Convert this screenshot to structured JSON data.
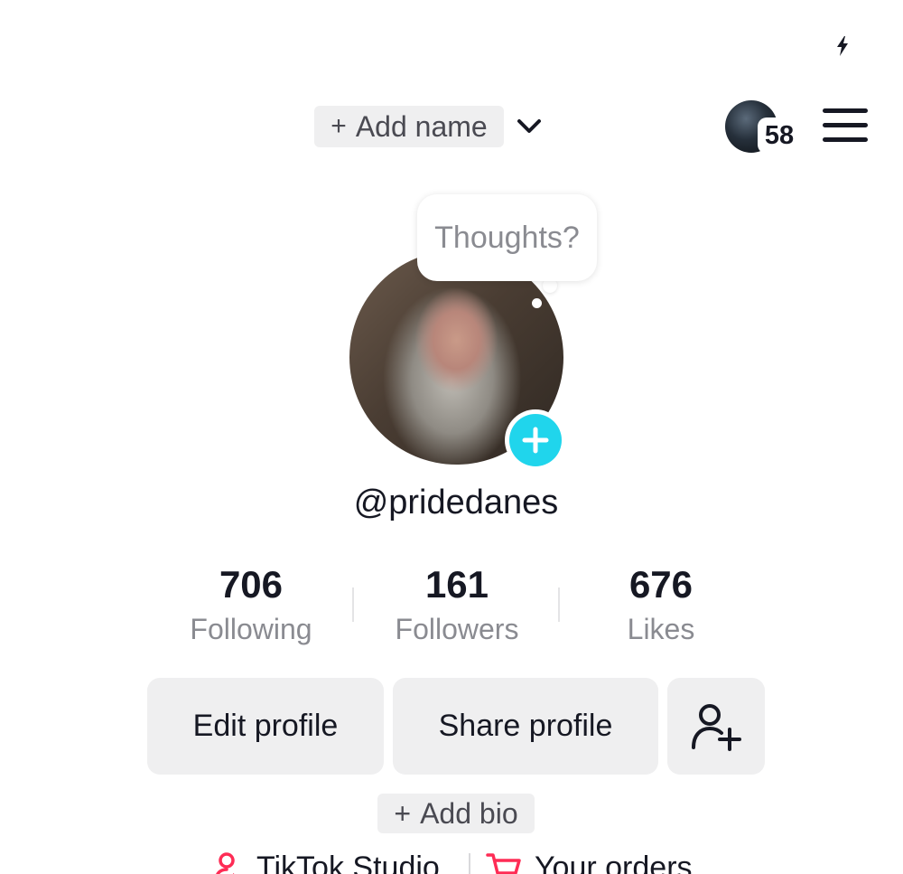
{
  "status": {
    "icon": "flash-icon"
  },
  "header": {
    "add_name_plus": "+",
    "add_name_label": "Add name",
    "dropdown_icon": "chevron-down-icon",
    "story_count": "58",
    "menu_icon": "hamburger-menu-icon"
  },
  "profile": {
    "thought_prompt": "Thoughts?",
    "username": "@pridedanes",
    "avatar_add_icon": "plus-icon"
  },
  "stats": [
    {
      "value": "706",
      "label": "Following"
    },
    {
      "value": "161",
      "label": "Followers"
    },
    {
      "value": "676",
      "label": "Likes"
    }
  ],
  "actions": {
    "edit_profile": "Edit profile",
    "share_profile": "Share profile",
    "add_friend_icon": "add-user-icon"
  },
  "bio": {
    "plus": "+",
    "label": "Add bio"
  },
  "links": [
    {
      "label": "TikTok Studio",
      "icon": "studio-person-icon",
      "color": "#fe2c55"
    },
    {
      "label": "Your orders",
      "icon": "cart-icon",
      "color": "#fe2c55"
    }
  ],
  "colors": {
    "accent": "#20d5ec",
    "brand": "#fe2c55",
    "button_bg": "#efeff0",
    "muted_text": "#8a8b91"
  }
}
